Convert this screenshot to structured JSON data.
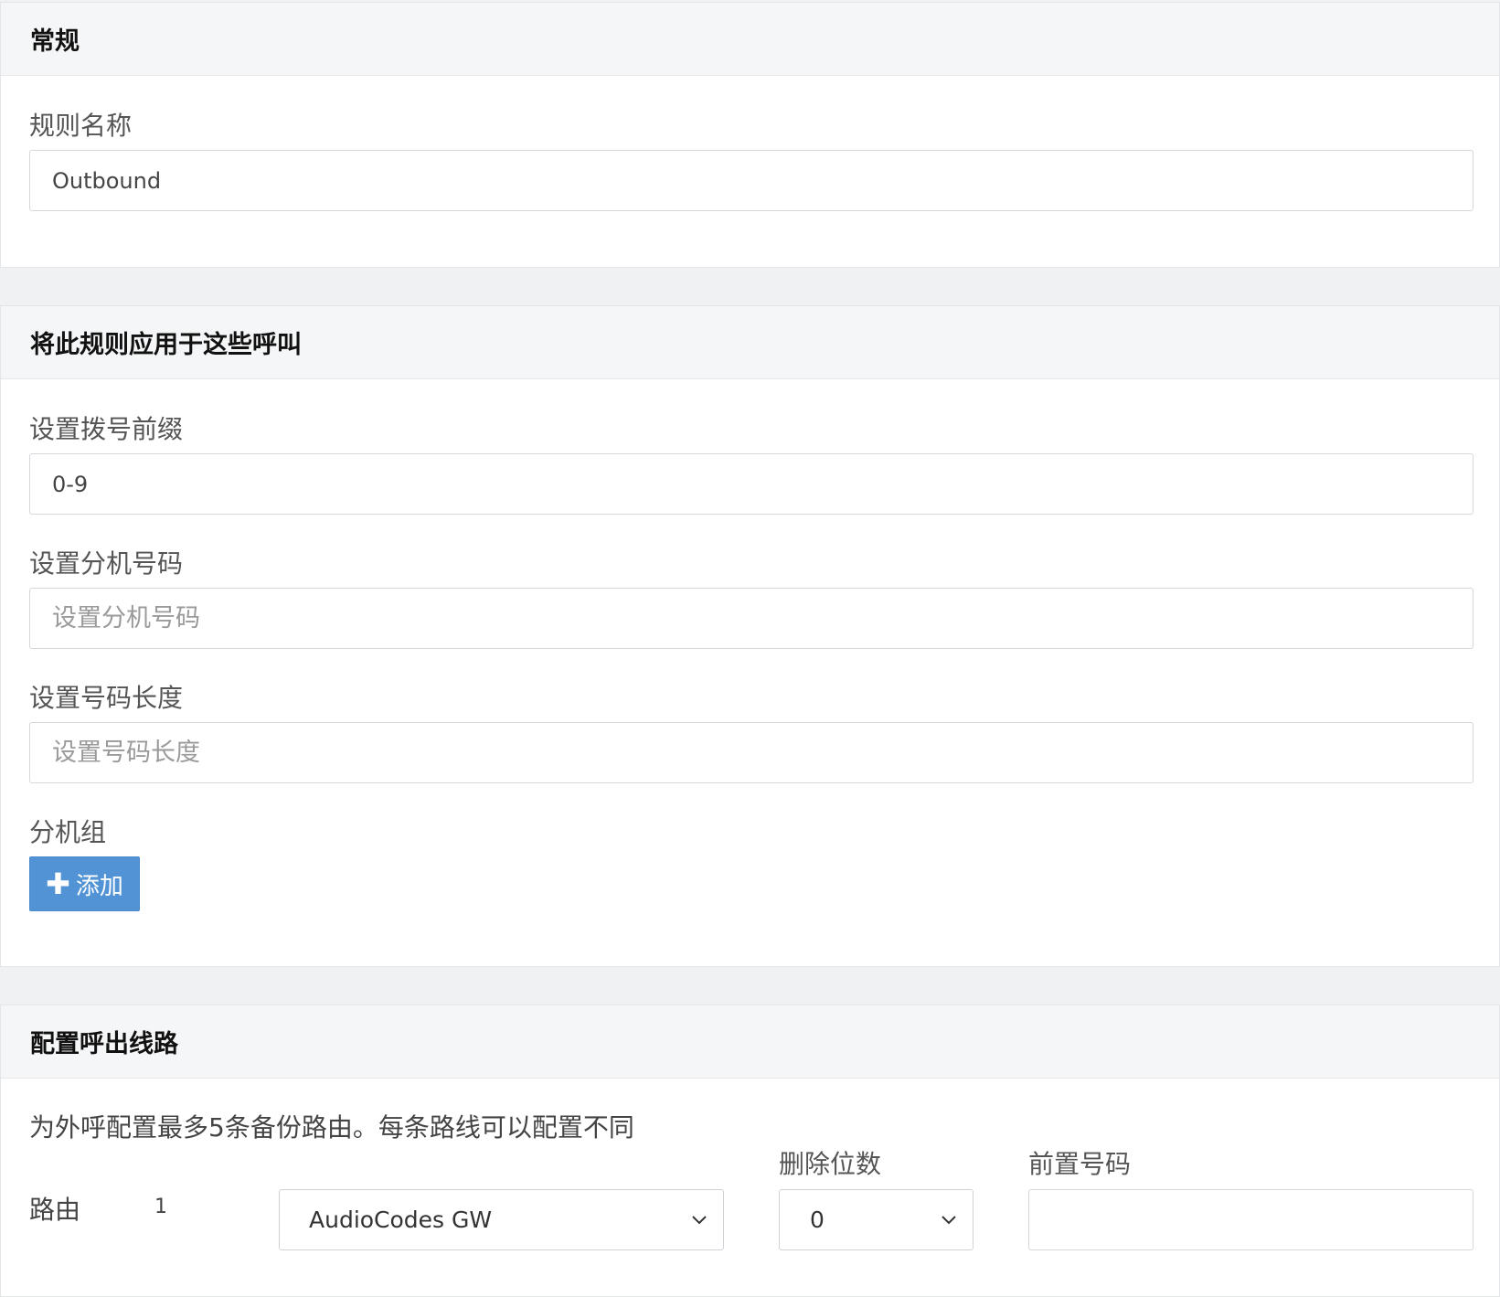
{
  "general": {
    "header": "常规",
    "rule_name_label": "规则名称",
    "rule_name_value": "Outbound"
  },
  "apply": {
    "header": "将此规则应用于这些呼叫",
    "prefix_label": "设置拨号前缀",
    "prefix_value": "0-9",
    "extension_label": "设置分机号码",
    "extension_placeholder": "设置分机号码",
    "length_label": "设置号码长度",
    "length_placeholder": "设置号码长度",
    "group_label": "分机组",
    "add_button_label": "添加"
  },
  "outbound": {
    "header": "配置呼出线路",
    "description": "为外呼配置最多5条备份路由。每条路线可以配置不同",
    "strip_digits_label": "删除位数",
    "prepend_label": "前置号码",
    "route_label": "路由",
    "routes": [
      {
        "number": "1",
        "trunk": "AudioCodes GW",
        "strip_digits": "0",
        "prepend": ""
      }
    ]
  },
  "icons": {
    "add": "plus-icon",
    "dropdown": "chevron-down-icon"
  },
  "colors": {
    "primary_button": "#5293d6",
    "page_background": "#f0f1f3",
    "panel_header_background": "#f5f6f7"
  }
}
